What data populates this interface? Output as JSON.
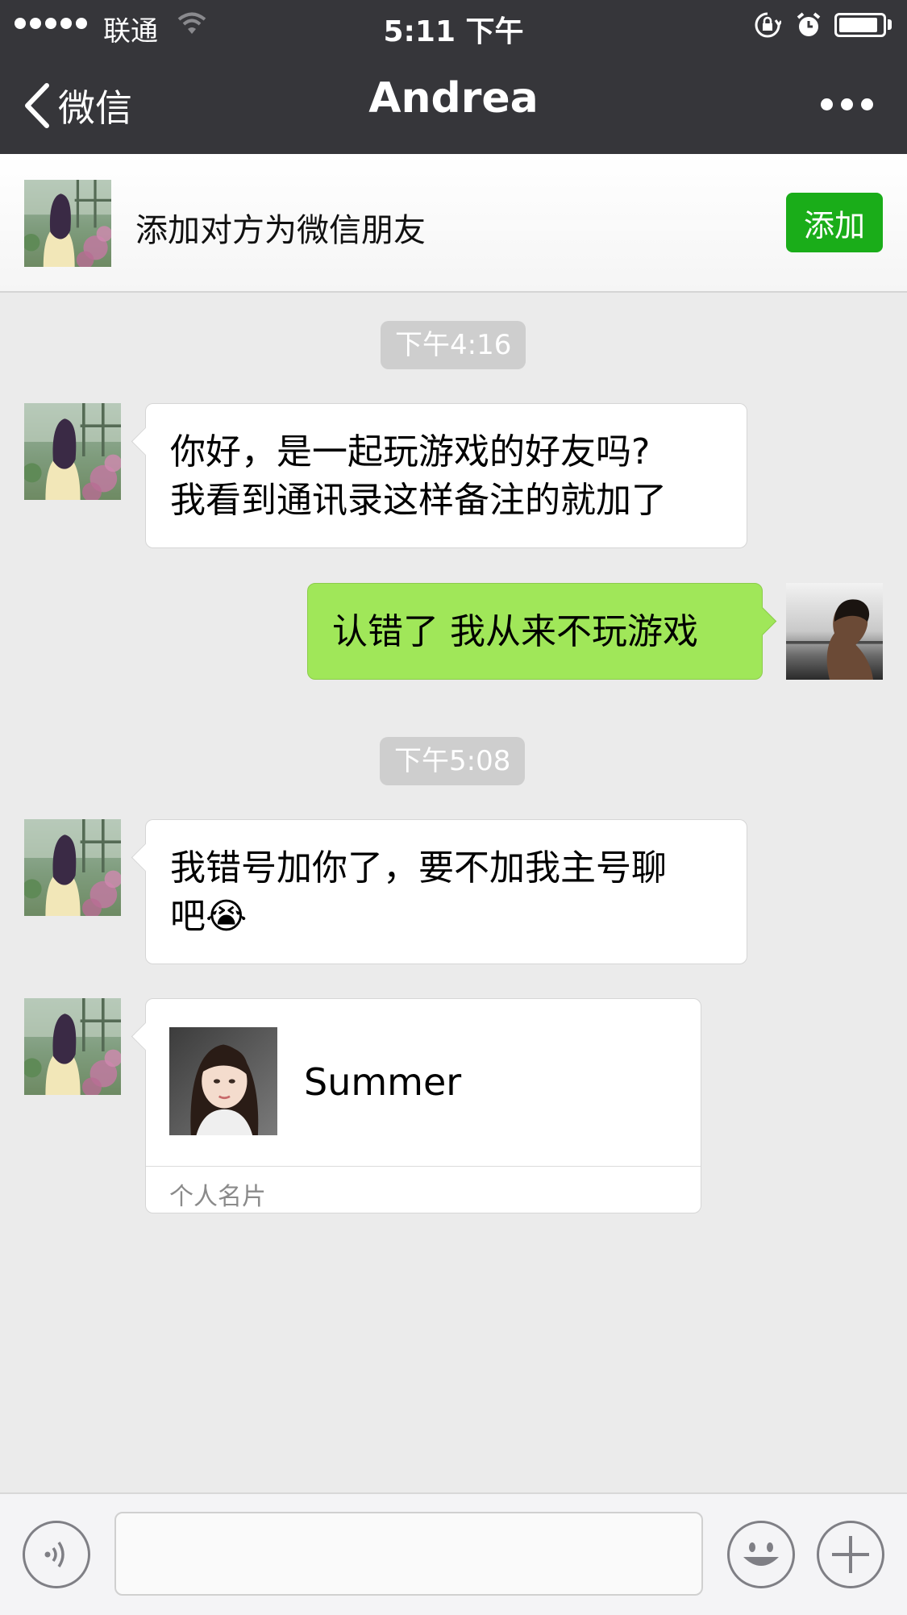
{
  "status_bar": {
    "carrier": "联通",
    "time": "5:11 下午",
    "battery_level": 0.9
  },
  "nav": {
    "back_label": "微信",
    "title": "Andrea"
  },
  "banner": {
    "text": "添加对方为微信朋友",
    "add_label": "添加"
  },
  "chat": {
    "timestamps": [
      "下午4:16",
      "下午5:08"
    ],
    "messages": [
      {
        "from": "them",
        "lines": [
          "你好，是一起玩游戏的好友吗?",
          "我看到通讯录这样备注的就加了"
        ]
      },
      {
        "from": "me",
        "lines": [
          "认错了 我从来不玩游戏"
        ]
      },
      {
        "from": "them",
        "lines": [
          "我错号加你了，要不加我主号聊",
          "吧😭"
        ]
      }
    ],
    "contact_card": {
      "name": "Summer",
      "label": "个人名片"
    }
  },
  "input_bar": {
    "voice_icon": "voice-icon",
    "emoji_icon": "emoji-icon",
    "plus_icon": "plus-icon",
    "text": ""
  },
  "colors": {
    "nav_bg": "#36363a",
    "chat_bg": "#ebebeb",
    "add_button": "#1aad19",
    "outgoing_bubble": "#a0e759",
    "incoming_bubble": "#ffffff"
  }
}
